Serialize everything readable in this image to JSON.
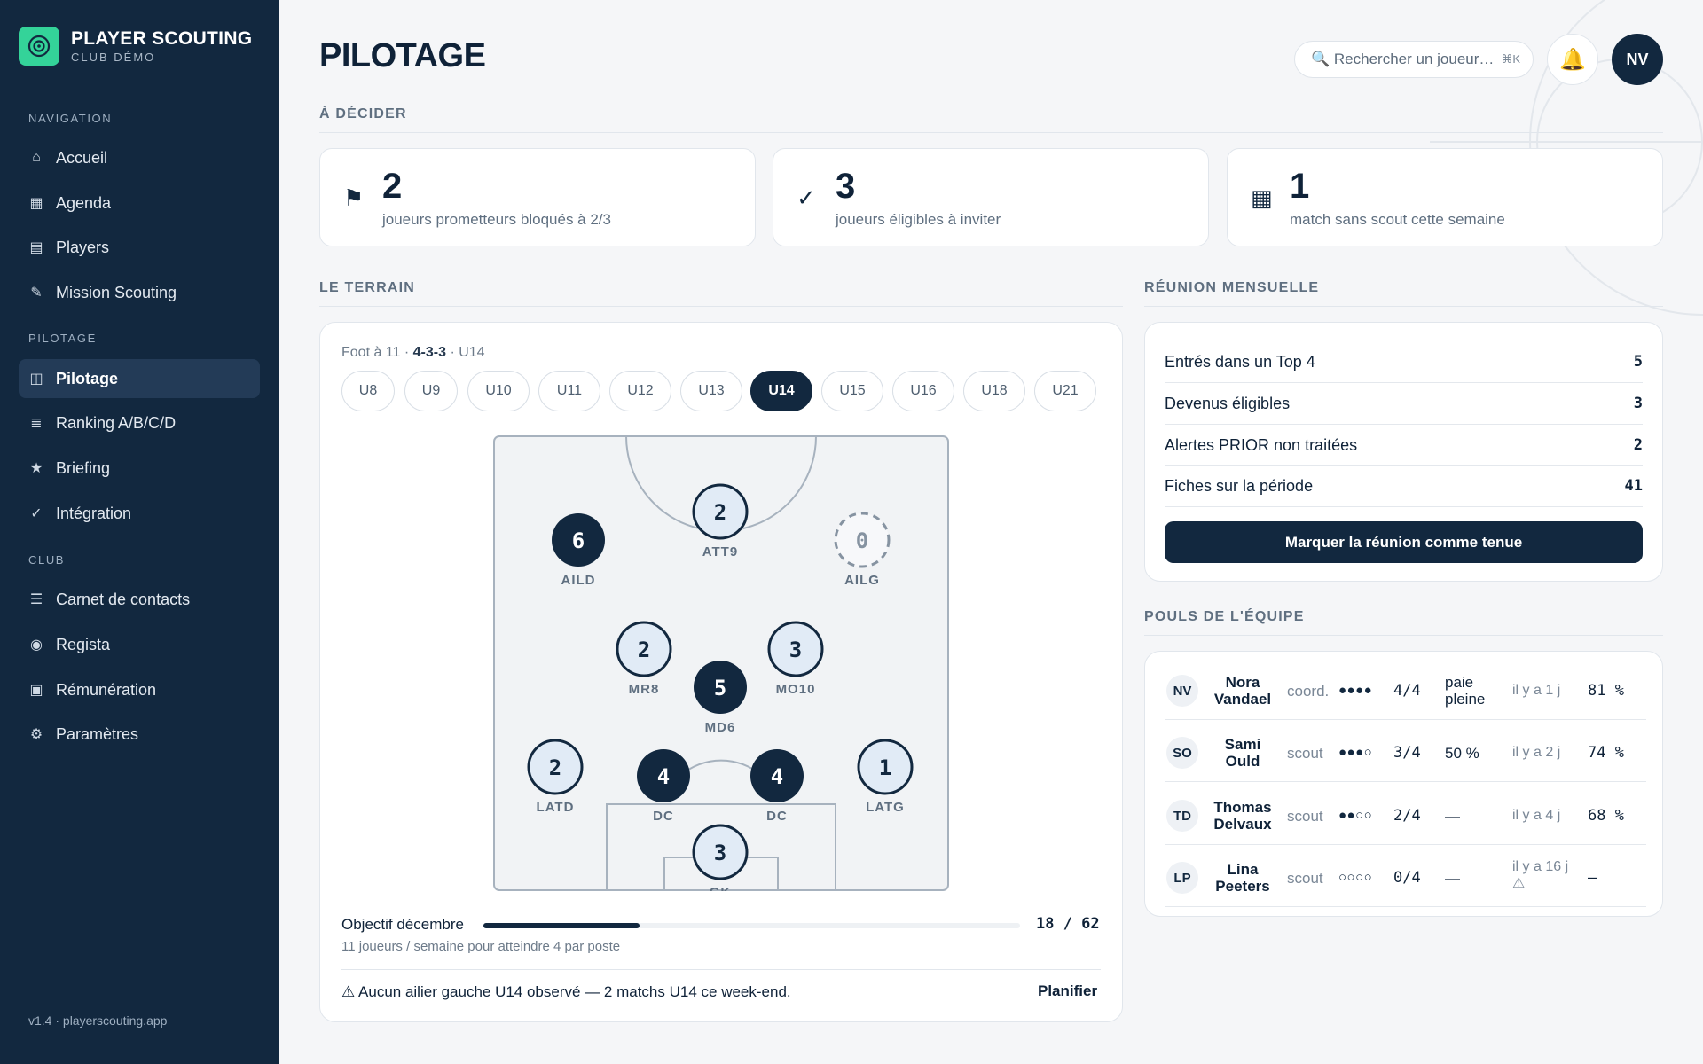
{
  "brand": {
    "title": "PLAYER SCOUTING",
    "subtitle": "CLUB DÉMO"
  },
  "sidebar": {
    "sections": [
      {
        "label": "NAVIGATION",
        "items": [
          {
            "icon": "home-icon",
            "glyph": "⌂",
            "label": "Accueil"
          },
          {
            "icon": "calendar-icon",
            "glyph": "▦",
            "label": "Agenda"
          },
          {
            "icon": "players-icon",
            "glyph": "▤",
            "label": "Players"
          },
          {
            "icon": "pencil-icon",
            "glyph": "✎",
            "label": "Mission Scouting"
          }
        ]
      },
      {
        "label": "PILOTAGE",
        "items": [
          {
            "icon": "dashboard-icon",
            "glyph": "◫",
            "label": "Pilotage",
            "active": true
          },
          {
            "icon": "ranking-icon",
            "glyph": "≣",
            "label": "Ranking A/B/C/D"
          },
          {
            "icon": "star-icon",
            "glyph": "★",
            "label": "Briefing"
          },
          {
            "icon": "check-icon",
            "glyph": "✓",
            "label": "Intégration"
          }
        ]
      },
      {
        "label": "CLUB",
        "items": [
          {
            "icon": "contacts-icon",
            "glyph": "☰",
            "label": "Carnet de contacts"
          },
          {
            "icon": "target-icon",
            "glyph": "◉",
            "label": "Regista"
          },
          {
            "icon": "payment-icon",
            "glyph": "▣",
            "label": "Rémunération"
          },
          {
            "icon": "gear-icon",
            "glyph": "⚙",
            "label": "Paramètres"
          }
        ]
      }
    ],
    "version": "v1.4 · playerscouting.app"
  },
  "header": {
    "title": "PILOTAGE",
    "search_placeholder": "Rechercher un joueur…",
    "search_shortcut": "⌘K",
    "bell_glyph": "🔔",
    "user_initials": "NV"
  },
  "decide": {
    "label": "À DÉCIDER",
    "cards": [
      {
        "icon": "flag-icon",
        "glyph": "⚑",
        "value": "2",
        "text": "joueurs prometteurs bloqués à 2/3"
      },
      {
        "icon": "check-icon",
        "glyph": "✓",
        "value": "3",
        "text": "joueurs éligibles à inviter"
      },
      {
        "icon": "calendar-icon",
        "glyph": "▦",
        "value": "1",
        "text": "match sans scout cette semaine"
      }
    ]
  },
  "terrain": {
    "label": "LE TERRAIN",
    "meta_prefix": "Foot à 11 · ",
    "meta_formation": "4-3-3",
    "meta_suffix": " · U14",
    "categories": [
      "U8",
      "U9",
      "U10",
      "U11",
      "U12",
      "U13",
      "U14",
      "U15",
      "U16",
      "U18",
      "U21"
    ],
    "active_category": "U14",
    "positions": [
      {
        "label": "ATT9",
        "count": 2,
        "style": "light"
      },
      {
        "label": "AILD",
        "count": 6,
        "style": "dark"
      },
      {
        "label": "AILG",
        "count": 0,
        "style": "empty"
      },
      {
        "label": "MR8",
        "count": 2,
        "style": "light"
      },
      {
        "label": "MO10",
        "count": 3,
        "style": "light"
      },
      {
        "label": "MD6",
        "count": 5,
        "style": "dark"
      },
      {
        "label": "LATD",
        "count": 2,
        "style": "light"
      },
      {
        "label": "DC",
        "count": 4,
        "style": "dark"
      },
      {
        "label": "DC",
        "count": 4,
        "style": "dark"
      },
      {
        "label": "LATG",
        "count": 1,
        "style": "light"
      },
      {
        "label": "GK",
        "count": 3,
        "style": "light"
      }
    ],
    "goal": {
      "label": "Objectif décembre",
      "current": 18,
      "target": 62,
      "display": "18 / 62",
      "subtitle": "11 joueurs / semaine pour atteindre 4 par poste"
    },
    "alert": {
      "text": "⚠ Aucun ailier gauche U14 observé — 2 matchs U14 ce week-end.",
      "action": "Planifier"
    }
  },
  "meeting": {
    "label": "RÉUNION MENSUELLE",
    "rows": [
      {
        "label": "Entrés dans un Top 4",
        "value": "5"
      },
      {
        "label": "Devenus éligibles",
        "value": "3"
      },
      {
        "label": "Alertes PRIOR non traitées",
        "value": "2"
      },
      {
        "label": "Fiches sur la période",
        "value": "41"
      }
    ],
    "button": "Marquer la réunion comme tenue"
  },
  "team": {
    "label": "POULS DE L'ÉQUIPE",
    "members": [
      {
        "initials": "NV",
        "name": "Nora Vandael",
        "role": "coord.",
        "dots": "●●●●",
        "ratio": "4/4",
        "load": "paie pleine",
        "last": "il y a 1 j",
        "pct": "81 %"
      },
      {
        "initials": "SO",
        "name": "Sami Ould",
        "role": "scout",
        "dots": "●●●○",
        "ratio": "3/4",
        "load": "50 %",
        "last": "il y a 2 j",
        "pct": "74 %"
      },
      {
        "initials": "TD",
        "name": "Thomas Delvaux",
        "role": "scout",
        "dots": "●●○○",
        "ratio": "2/4",
        "load": "—",
        "last": "il y a 4 j",
        "pct": "68 %"
      },
      {
        "initials": "LP",
        "name": "Lina Peeters",
        "role": "scout",
        "dots": "○○○○",
        "ratio": "0/4",
        "load": "—",
        "last": "il y a 16 j ⚠",
        "pct": "—"
      }
    ]
  },
  "colors": {
    "navy": "#12283f",
    "accent": "#34d399",
    "muted": "#5f6f80",
    "light_circle": "#e1ebf6"
  }
}
